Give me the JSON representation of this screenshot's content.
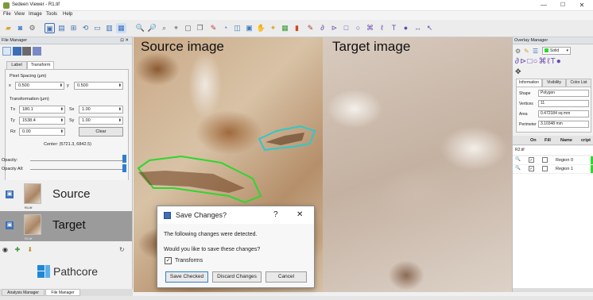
{
  "window": {
    "title": "Sedeen Viewer - R1.tif",
    "minimize": "—",
    "maximize": "☐",
    "close": "✕"
  },
  "menu": [
    "File",
    "View",
    "Image",
    "Tools",
    "Help"
  ],
  "file_manager": {
    "title": "File Manager",
    "tabs": [
      "Label",
      "Transform"
    ],
    "pixel_spacing_label": "Pixel Spacing (μm)",
    "x_label": "x",
    "x_value": "0.500",
    "y_label": "y",
    "y_value": "0.500",
    "transformation_label": "Transformation (μm)",
    "tx_label": "Tx",
    "tx_value": "180.1",
    "ty_label": "Ty",
    "ty_value": "1538.4",
    "rz_label": "Rz",
    "rz_value": "0.00",
    "sx_label": "Sx",
    "sx_value": "1.00",
    "sy_label": "Sy",
    "sy_value": "1.00",
    "clear_label": "Clear",
    "center_text": "Center: (5721.3, 6842.5)",
    "opacity_label": "Opacity:",
    "opacity_all_label": "Opacity All:",
    "images": [
      {
        "label": "Source",
        "file": "R1.tif"
      },
      {
        "label": "Target",
        "file": "R1.tif"
      }
    ],
    "logo_text": "Pathcore"
  },
  "viewers": {
    "source_label": "Source image",
    "target_label": "Target image"
  },
  "overlay_manager": {
    "title": "Overlay Manager",
    "style_value": "Solid",
    "tabs": [
      "Information",
      "Visibility",
      "Color List"
    ],
    "shape_label": "Shape",
    "shape_value": "Polygon",
    "vertices_label": "Vertices",
    "vertices_value": "11",
    "area_label": "Area",
    "area_value": "0.472184 sq mm",
    "perimeter_label": "Perimeter",
    "perimeter_value": "3.10348 mm",
    "columns": [
      "On",
      "Fill",
      "Name",
      "cript"
    ],
    "group": "R2.tif",
    "regions": [
      "Region 0",
      "Region 1"
    ]
  },
  "dialog": {
    "title": "Save Changes?",
    "help": "?",
    "close": "✕",
    "message": "The following changes were detected.",
    "question": "Would you like to save these changes?",
    "checkbox_label": "Transforms",
    "buttons": [
      "Save Checked",
      "Discard Changes",
      "Cancel"
    ]
  },
  "bottom_tabs": [
    "Analysis Manager",
    "File Manager"
  ],
  "colors": {
    "accent": "#2f7fd1",
    "green_region": "#2fd62f",
    "cyan_region": "#2fc8c8",
    "logo_blue": "#1e88d8"
  }
}
